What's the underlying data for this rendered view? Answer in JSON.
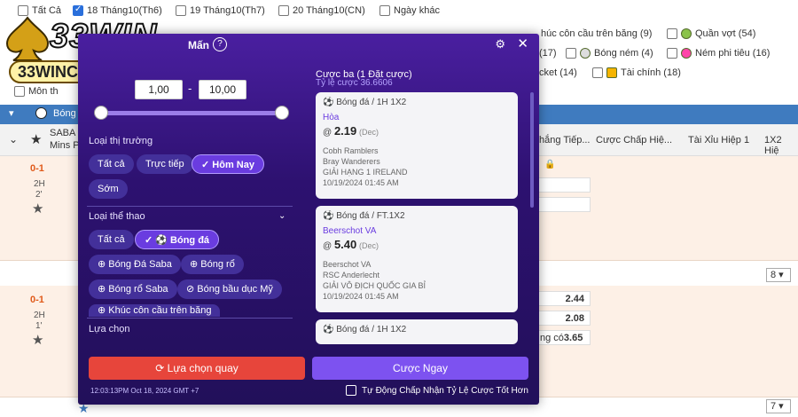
{
  "filters": {
    "date_options": [
      {
        "label": "Tất Cả",
        "checked": false
      },
      {
        "label": "18 Tháng10(Th6)",
        "checked": true
      },
      {
        "label": "19 Tháng10(Th7)",
        "checked": false
      },
      {
        "label": "20 Tháng10(CN)",
        "checked": false
      },
      {
        "label": "Ngày khác",
        "checked": false
      }
    ],
    "sport_options": [
      {
        "label": "húc côn cầu trên băng (9)"
      },
      {
        "label": "Quần vợt (54)"
      },
      {
        "label": "Bóng ném (4)"
      },
      {
        "label": "Ném phi tiêu (16)"
      },
      {
        "label": "Tài chính (18)"
      },
      {
        "label": "(17)"
      },
      {
        "label": "cket (14)"
      }
    ],
    "extra": "Môn th"
  },
  "logo": {
    "brand": "33WIN",
    "site": "33WINCOM.CLUB"
  },
  "table": {
    "sport_bar_label": "Bóng",
    "col_league": "SABA",
    "col_league2": "Mins P",
    "col_headers": [
      "hắng Tiếp...",
      "Cược Chấp Hiệ...",
      "Tài Xỉu Hiệp 1",
      "1X2 Hiệ"
    ],
    "match1": {
      "score": "0-1",
      "period": "2H",
      "minute": "2'"
    },
    "match2": {
      "score": "0-1",
      "period": "2H",
      "minute": "1'"
    },
    "odds2": [
      "2.44",
      "2.08",
      "3.65"
    ],
    "odds2_label": "ng có",
    "pager1": "8",
    "pager2": "7"
  },
  "modal": {
    "title": "Mấn",
    "help": "?",
    "range_min": "1,00",
    "range_max": "10,00",
    "range_dash": "-",
    "market_label": "Loại thị trường",
    "market_chips": [
      "Tất cả",
      "Trực tiếp",
      "Hôm Nay",
      "Sớm"
    ],
    "market_selected": "Hôm Nay",
    "sport_label": "Loại thể thao",
    "sport_chips": [
      "Tất cả",
      "Bóng đá",
      "Bóng Đá Saba",
      "Bóng rổ",
      "Bóng rổ Saba",
      "Bóng bầu dục Mỹ",
      "Khúc côn cầu trên băng"
    ],
    "choice_label": "Lựa chọn",
    "right_title": "Cược ba (1 Đặt cược)",
    "right_odds": "Tỷ lệ cược 36.6606",
    "bets": [
      {
        "market": "Bóng đá / 1H 1X2",
        "selection": "Hòa",
        "odds": "2.19",
        "odds_type": "(Dec)",
        "home": "Cobh Ramblers",
        "away": "Bray Wanderers",
        "league": "GIẢI HẠNG 1 IRELAND",
        "time": "10/19/2024 01:45 AM"
      },
      {
        "market": "Bóng đá / FT.1X2",
        "selection": "Beerschot VA",
        "odds": "5.40",
        "odds_type": "(Dec)",
        "home": "Beerschot VA",
        "away": "RSC Anderlecht",
        "league": "GIẢI VÔ ĐỊCH QUỐC GIA BỈ",
        "time": "10/19/2024 01:45 AM"
      },
      {
        "market": "Bóng đá / 1H 1X2",
        "selection": "",
        "odds": "",
        "odds_type": "",
        "home": "",
        "away": "",
        "league": "",
        "time": ""
      }
    ],
    "btn_replay": "Lựa chọn quay",
    "btn_bet": "Cược Ngay",
    "timestamp": "12:03:13PM Oct 18, 2024 GMT +7",
    "auto_accept": "Tự Động Chấp Nhận Tỷ Lệ Cược Tốt Hơn"
  },
  "colors": {
    "modal_bg": "#2d1170",
    "accent": "#7d52f0",
    "danger": "#e7453b",
    "score": "#e05a1a"
  }
}
